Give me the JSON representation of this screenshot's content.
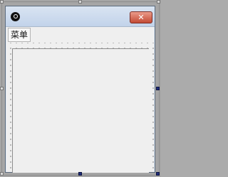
{
  "window": {
    "title": "",
    "menu_label": "菜单",
    "close_symbol": "✕",
    "app_icon_name": "app-icon",
    "close_icon_name": "close-icon",
    "colors": {
      "title_bar": "#c8d7ec",
      "close_button": "#d15a45",
      "selection_handle": "#1f2c7a"
    }
  }
}
